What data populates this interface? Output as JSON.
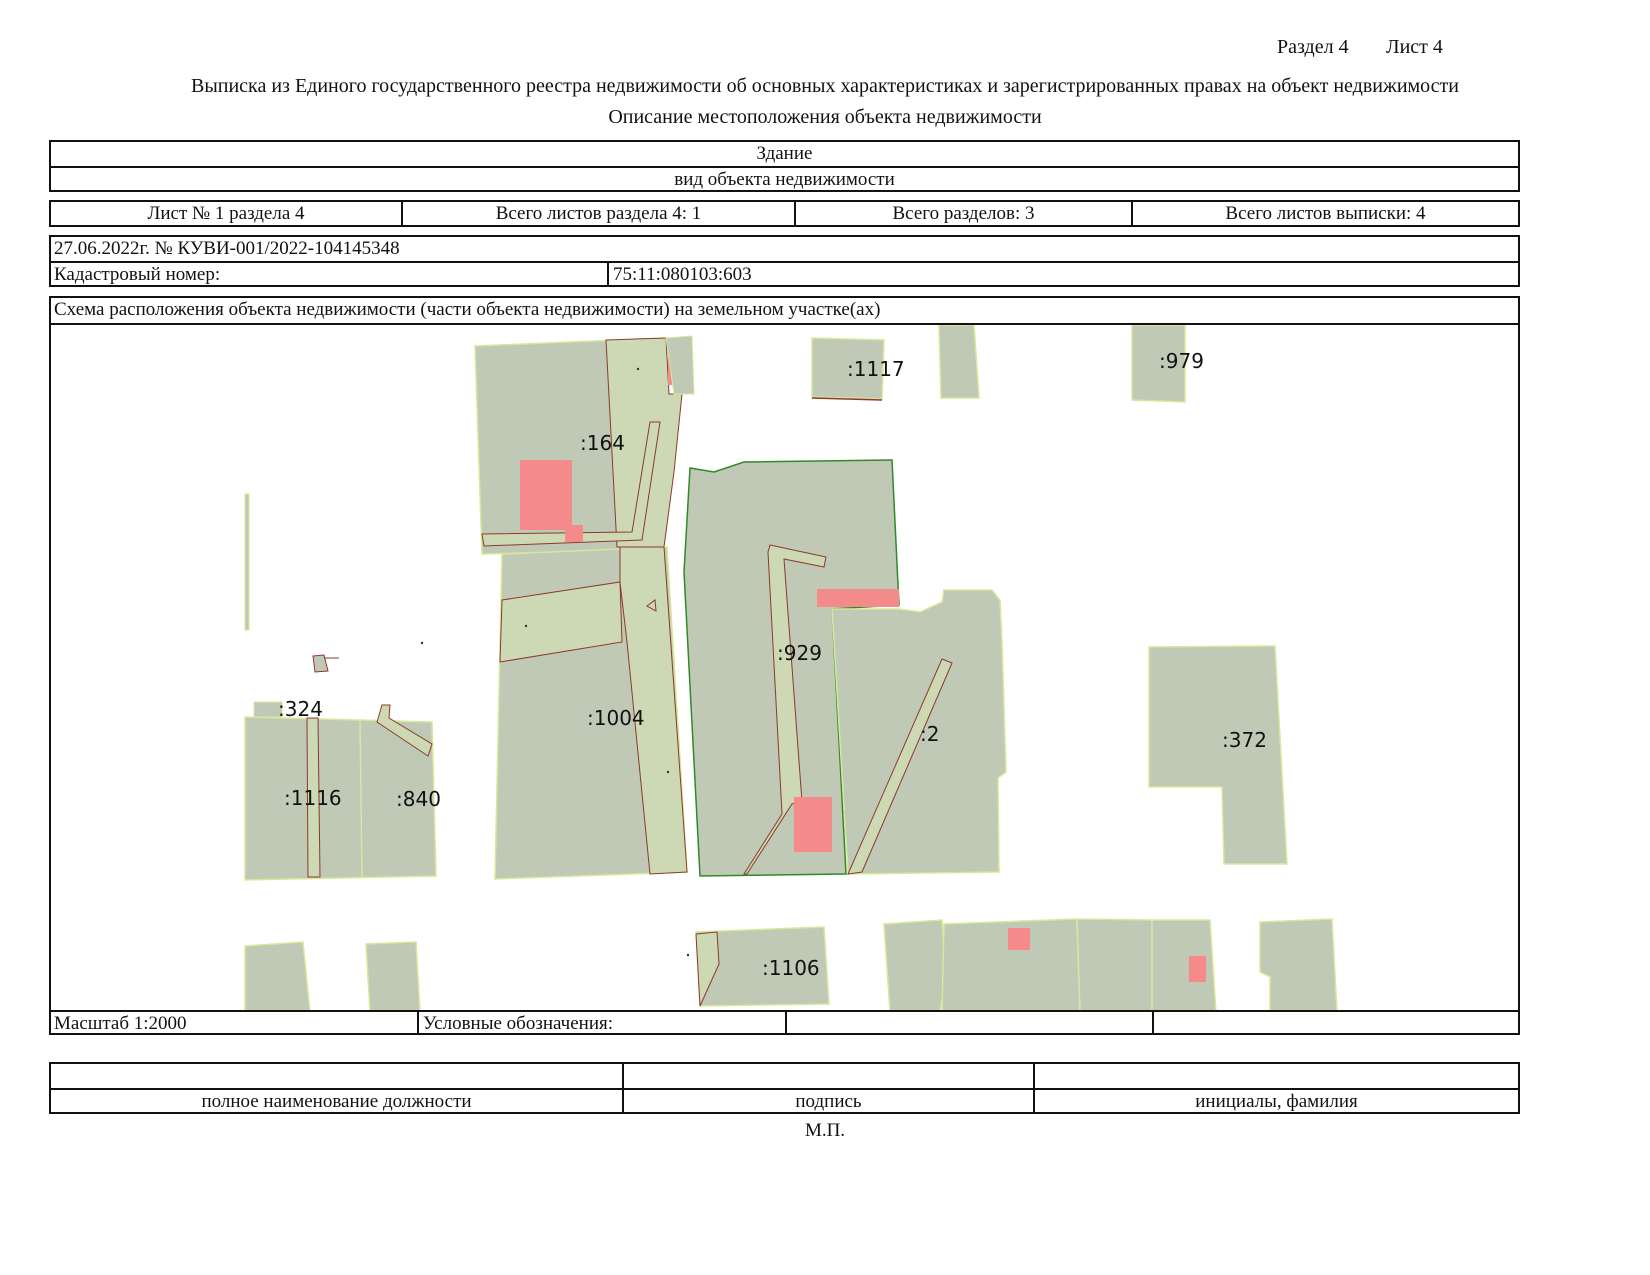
{
  "header": {
    "section_label": "Раздел 4",
    "sheet_label": "Лист 4",
    "title": "Выписка из Единого государственного реестра недвижимости об основных характеристиках и зарегистрированных правах на объект недвижимости",
    "subtitle": "Описание местоположения объекта недвижимости"
  },
  "object": {
    "type": "Здание",
    "type_caption": "вид объекта недвижимости"
  },
  "sheets": {
    "sheet_no": "Лист № 1 раздела 4",
    "total_section_sheets": "Всего листов раздела 4: 1",
    "total_sections": "Всего разделов: 3",
    "total_extract_sheets": "Всего листов выписки: 4"
  },
  "record": {
    "date_number": "27.06.2022г. № КУВИ-001/2022-104145348",
    "cadastral_label": "Кадастровый номер:",
    "cadastral_value": "75:11:080103:603"
  },
  "scheme": {
    "caption": "Схема расположения объекта недвижимости (части объекта недвижимости) на земельном участке(ах)",
    "scale": "Масштаб 1:2000",
    "legend": "Условные обозначения:",
    "legend_cell_2": "",
    "legend_cell_3": "",
    "parcel_labels": [
      ":164",
      ":1117",
      ":979",
      ":929",
      ":324",
      ":1004",
      ":2",
      ":372",
      ":1116",
      ":840",
      ":1106"
    ],
    "colors": {
      "parcel_fill": "#bfc9b6",
      "strip_fill": "#ccd9b4",
      "building_fill": "#f58a8a",
      "border_brown": "#8c3a2b",
      "border_yellow": "#d8e89a",
      "selected_border": "#2f8a2a"
    }
  },
  "signature": {
    "position": "полное наименование должности",
    "signature": "подпись",
    "name": "инициалы, фамилия",
    "stamp": "М.П."
  }
}
